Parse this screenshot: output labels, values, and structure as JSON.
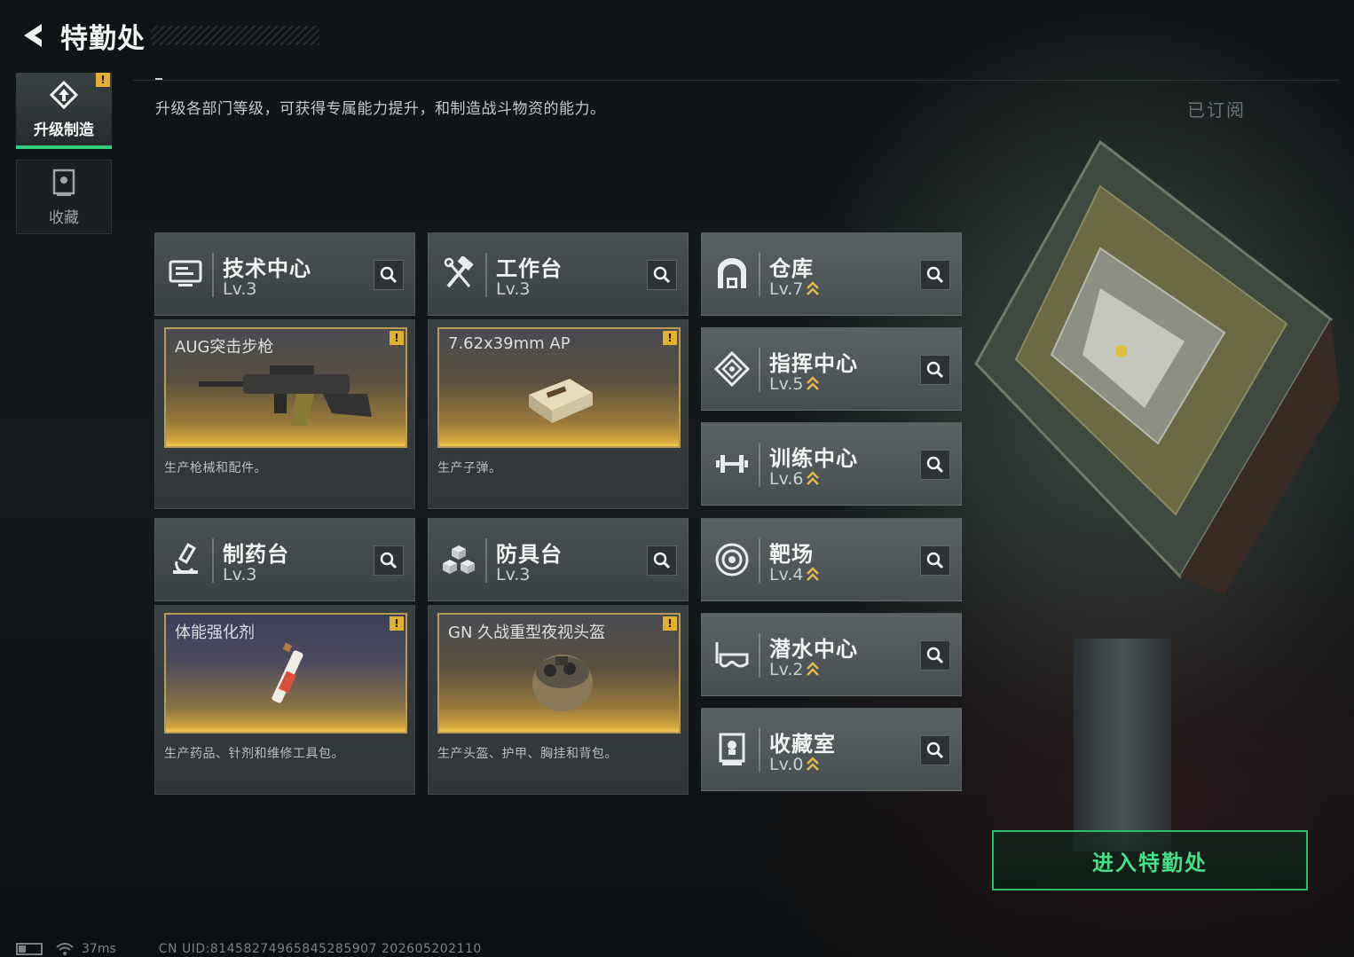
{
  "header": {
    "title": "特勤处"
  },
  "side_tabs": [
    {
      "label": "升级制造",
      "active": true,
      "alert": "!"
    },
    {
      "label": "收藏",
      "active": false
    }
  ],
  "description": "升级各部门等级，可获得专属能力提升，和制造战斗物资的能力。",
  "subscribed_label": "已订阅",
  "departments": {
    "tech": {
      "name": "技术中心",
      "level": "Lv.3",
      "product": {
        "name": "AUG突击步枪",
        "desc": "生产枪械和配件。",
        "alert": "!"
      }
    },
    "workbench": {
      "name": "工作台",
      "level": "Lv.3",
      "product": {
        "name": "7.62x39mm AP",
        "desc": "生产子弹。",
        "alert": "!"
      }
    },
    "pharmacy": {
      "name": "制药台",
      "level": "Lv.3",
      "product": {
        "name": "体能强化剂",
        "desc": "生产药品、针剂和维修工具包。",
        "alert": "!"
      }
    },
    "armor": {
      "name": "防具台",
      "level": "Lv.3",
      "product": {
        "name": "GN 久战重型夜视头盔",
        "desc": "生产头盔、护甲、胸挂和背包。",
        "alert": "!"
      }
    },
    "warehouse": {
      "name": "仓库",
      "level": "Lv.7"
    },
    "command": {
      "name": "指挥中心",
      "level": "Lv.5"
    },
    "training": {
      "name": "训练中心",
      "level": "Lv.6"
    },
    "range": {
      "name": "靶场",
      "level": "Lv.4"
    },
    "diving": {
      "name": "潜水中心",
      "level": "Lv.2"
    },
    "collection": {
      "name": "收藏室",
      "level": "Lv.0"
    }
  },
  "enter_button": "进入特勤处",
  "footer": {
    "ping": "37ms",
    "uid": "CN UID:8145827496584528590​7 202605202110"
  },
  "colors": {
    "accent_green": "#2bbf6c",
    "alert_yellow": "#e0b02e",
    "upgrade_gold": "#e6b84a"
  }
}
